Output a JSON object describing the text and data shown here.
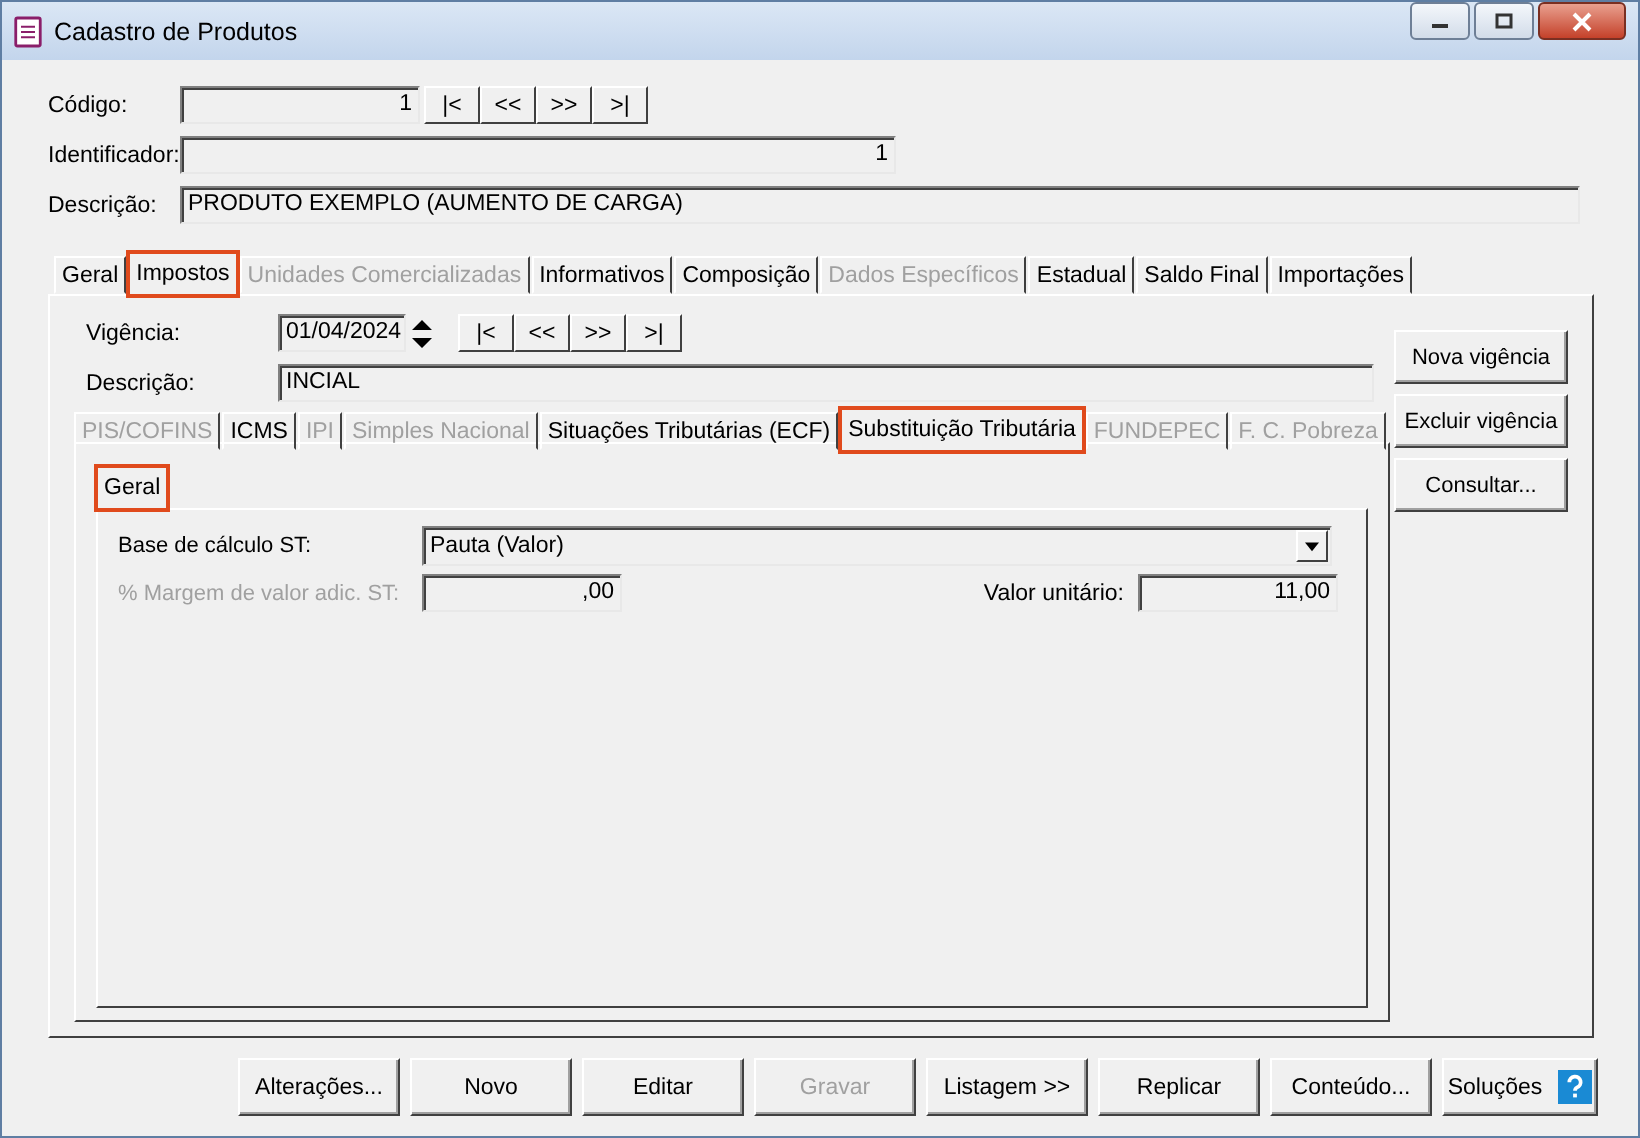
{
  "window": {
    "title": "Cadastro de Produtos"
  },
  "codigo": {
    "label": "Código:",
    "value": "1",
    "nav": [
      "|<",
      "<<",
      ">>",
      ">|"
    ]
  },
  "identificador": {
    "label": "Identificador:",
    "value": "1"
  },
  "descricao": {
    "label": "Descrição:",
    "value": "PRODUTO EXEMPLO (AUMENTO DE CARGA)"
  },
  "tabs": [
    {
      "label": "Geral",
      "selected": false,
      "disabled": false,
      "highlighted": false
    },
    {
      "label": "Impostos",
      "selected": true,
      "disabled": false,
      "highlighted": true
    },
    {
      "label": "Unidades Comercializadas",
      "selected": false,
      "disabled": true,
      "highlighted": false
    },
    {
      "label": "Informativos",
      "selected": false,
      "disabled": false,
      "highlighted": false
    },
    {
      "label": "Composição",
      "selected": false,
      "disabled": false,
      "highlighted": false
    },
    {
      "label": "Dados Específicos",
      "selected": false,
      "disabled": true,
      "highlighted": false
    },
    {
      "label": "Estadual",
      "selected": false,
      "disabled": false,
      "highlighted": false
    },
    {
      "label": "Saldo Final",
      "selected": false,
      "disabled": false,
      "highlighted": false
    },
    {
      "label": "Importações",
      "selected": false,
      "disabled": false,
      "highlighted": false
    }
  ],
  "impostos": {
    "vigencia": {
      "label": "Vigência:",
      "value": "01/04/2024",
      "nav": [
        "|<",
        "<<",
        ">>",
        ">|"
      ]
    },
    "descricao": {
      "label": "Descrição:",
      "value": "INCIAL"
    },
    "side_buttons": [
      "Nova vigência",
      "Excluir vigência",
      "Consultar..."
    ],
    "tabs": [
      {
        "label": "PIS/COFINS",
        "selected": false,
        "disabled": true,
        "highlighted": false
      },
      {
        "label": "ICMS",
        "selected": false,
        "disabled": false,
        "highlighted": false
      },
      {
        "label": "IPI",
        "selected": false,
        "disabled": true,
        "highlighted": false
      },
      {
        "label": "Simples Nacional",
        "selected": false,
        "disabled": true,
        "highlighted": false
      },
      {
        "label": "Situações Tributárias (ECF)",
        "selected": false,
        "disabled": false,
        "highlighted": false
      },
      {
        "label": "Substituição Tributária",
        "selected": true,
        "disabled": false,
        "highlighted": true
      },
      {
        "label": "FUNDEPEC",
        "selected": false,
        "disabled": true,
        "highlighted": false
      },
      {
        "label": "F. C. Pobreza",
        "selected": false,
        "disabled": true,
        "highlighted": false
      }
    ],
    "sub_tabs": [
      {
        "label": "Geral",
        "selected": true,
        "disabled": false,
        "highlighted": true
      }
    ],
    "base": {
      "label": "Base de cálculo ST:",
      "value": "Pauta (Valor)"
    },
    "margem": {
      "label": "% Margem de valor adic. ST:",
      "value": ",00",
      "disabled": true
    },
    "valor": {
      "label": "Valor unitário:",
      "value": "11,00"
    }
  },
  "buttons": [
    {
      "label": "Alterações...",
      "disabled": false,
      "kind": "plain"
    },
    {
      "label": "Novo",
      "disabled": false,
      "kind": "plain"
    },
    {
      "label": "Editar",
      "disabled": false,
      "kind": "plain"
    },
    {
      "label": "Gravar",
      "disabled": true,
      "kind": "plain"
    },
    {
      "label": "Listagem >>",
      "disabled": false,
      "kind": "plain"
    },
    {
      "label": "Replicar",
      "disabled": false,
      "kind": "plain"
    },
    {
      "label": "Conteúdo...",
      "disabled": false,
      "kind": "plain"
    },
    {
      "label": "Soluções",
      "disabled": false,
      "kind": "help"
    }
  ]
}
